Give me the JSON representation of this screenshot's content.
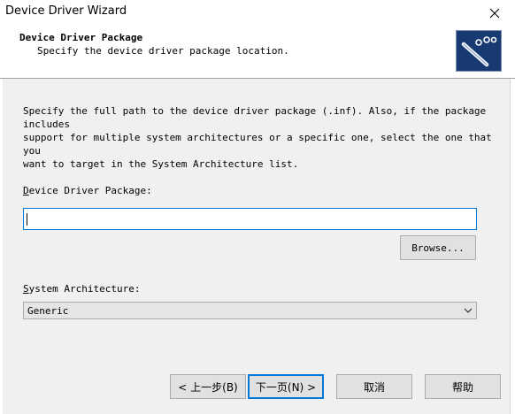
{
  "window": {
    "title": "Device Driver Wizard"
  },
  "header": {
    "title": "Device Driver Package",
    "subtitle": "Specify the device driver package location."
  },
  "body": {
    "description": "Specify the full path to the device driver package (.inf). Also, if the package includes\nsupport for multiple system architectures or a specific one, select the one that you\nwant to target in the System Architecture list.",
    "package_label_key": "D",
    "package_label_rest": "evice Driver Package:",
    "package_input_value": "",
    "browse_label": "Browse...",
    "arch_label_key": "S",
    "arch_label_rest": "ystem Architecture:",
    "arch_selected": "Generic"
  },
  "footer": {
    "back_label": "< 上一步(B)",
    "next_label": "下一页(N) >",
    "cancel_label": "取消",
    "help_label": "帮助"
  },
  "icons": {
    "close": "close-icon",
    "wizard": "wizard-cable-icon",
    "dropdown": "chevron-down-icon"
  },
  "colors": {
    "accent": "#0078d7",
    "icon_bg": "#173a73",
    "button_bg": "#e1e1e1",
    "panel_bg": "#f0f0f0"
  }
}
